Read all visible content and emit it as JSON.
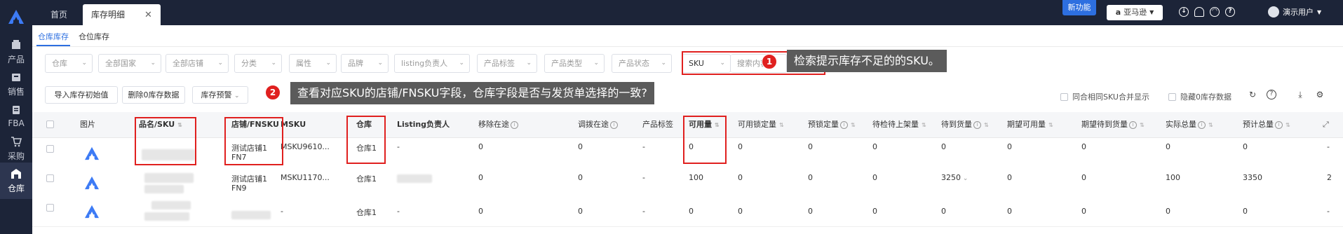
{
  "sidebar": {
    "items": [
      {
        "label": "产品",
        "icon": "box-icon"
      },
      {
        "label": "销售",
        "icon": "cart-icon"
      },
      {
        "label": "FBA",
        "icon": "truck-icon"
      },
      {
        "label": "采购",
        "icon": "cart2-icon"
      },
      {
        "label": "仓库",
        "icon": "warehouse-icon"
      }
    ]
  },
  "topbar": {
    "tabs": [
      {
        "label": "首页"
      },
      {
        "label": "库存明细",
        "close": "✕"
      }
    ],
    "new_feature": "新功能",
    "platform": "亚马逊",
    "user": "演示用户"
  },
  "subtabs": [
    "仓库库存",
    "仓位库存"
  ],
  "filters": [
    {
      "label": "仓库"
    },
    {
      "label": "全部国家"
    },
    {
      "label": "全部店铺"
    },
    {
      "label": "分类"
    },
    {
      "label": "属性"
    },
    {
      "label": "品牌"
    },
    {
      "label": "listing负责人"
    },
    {
      "label": "产品标签"
    },
    {
      "label": "产品类型"
    },
    {
      "label": "产品状态"
    }
  ],
  "search": {
    "select": "SKU",
    "placeholder": "搜索内容"
  },
  "buttons": {
    "init": "导入库存初始值",
    "delete_zero": "删除0库存数据",
    "warning": "库存预警"
  },
  "options": {
    "merge": "同合相同SKU合并显示",
    "hide_zero": "隐藏0库存数据"
  },
  "columns": [
    "图片",
    "品名/SKU",
    "店铺/FNSKU",
    "MSKU",
    "仓库",
    "Listing负责人",
    "移除在途",
    "调拨在途",
    "产品标签",
    "可用量",
    "可用锁定量",
    "预锁定量",
    "待检待上架量",
    "待到货量",
    "期望可用量",
    "期望待到货量",
    "实际总量",
    "预计总量"
  ],
  "rows": [
    {
      "shop": "测试店铺1",
      "fnsku": "FN7",
      "msku": "MSKU9610...",
      "wh": "仓库1",
      "owner": "-",
      "remove": "0",
      "transfer": "0",
      "tag": "-",
      "avail": "0",
      "lock": "0",
      "prelock": "0",
      "pending": "0",
      "incoming": "0",
      "exp_avail": "0",
      "exp_incoming": "0",
      "actual": "0",
      "total": "0",
      "extra": "-"
    },
    {
      "shop": "测试店铺1",
      "fnsku": "FN9",
      "msku": "MSKU1170...",
      "wh": "仓库1",
      "owner": "",
      "remove": "0",
      "transfer": "0",
      "tag": "-",
      "avail": "100",
      "lock": "0",
      "prelock": "0",
      "pending": "0",
      "incoming": "3250",
      "exp_avail": "0",
      "exp_incoming": "0",
      "actual": "100",
      "total": "3350",
      "extra": "2"
    },
    {
      "shop": "",
      "fnsku": "",
      "msku": "-",
      "wh": "仓库1",
      "owner": "-",
      "remove": "0",
      "transfer": "0",
      "tag": "-",
      "avail": "0",
      "lock": "0",
      "prelock": "0",
      "pending": "0",
      "incoming": "0",
      "exp_avail": "0",
      "exp_incoming": "0",
      "actual": "0",
      "total": "0",
      "extra": "-"
    }
  ],
  "callouts": [
    {
      "num": "1",
      "text": "检索提示库存不足的的SKU。"
    },
    {
      "num": "2",
      "text": "查看对应SKU的店铺/FNSKU字段，仓库字段是否与发货单选择的一致?"
    }
  ],
  "colors": {
    "sidebar": "#1c2438",
    "accent": "#2d6fe0",
    "highlight": "#e0201f",
    "callout_bg": "#5b5b5b"
  }
}
